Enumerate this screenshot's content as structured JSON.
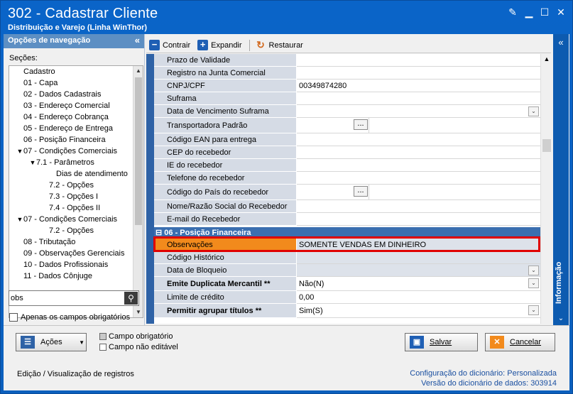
{
  "window": {
    "title": "302 - Cadastrar Cliente",
    "subtitle": "Distribuição e Varejo (Linha WinThor)"
  },
  "nav": {
    "header": "Opções de navegação",
    "sections_label": "Seções:",
    "items": [
      {
        "label": "Cadastro",
        "expander": ""
      },
      {
        "label": "01 - Capa",
        "expander": ""
      },
      {
        "label": "02 - Dados Cadastrais",
        "expander": ""
      },
      {
        "label": "03 - Endereço Comercial",
        "expander": ""
      },
      {
        "label": "04 - Endereço Cobrança",
        "expander": ""
      },
      {
        "label": "05 - Endereço de Entrega",
        "expander": ""
      },
      {
        "label": "06 - Posição Financeira",
        "expander": ""
      },
      {
        "label": "07 - Condições Comerciais",
        "expander": "▼"
      },
      {
        "label": "7.1 - Parâmetros",
        "expander": "▼"
      },
      {
        "label": "Dias de atendimento",
        "expander": ""
      },
      {
        "label": "7.2 - Opções",
        "expander": ""
      },
      {
        "label": "7.3 - Opções I",
        "expander": ""
      },
      {
        "label": "7.4 - Opções II",
        "expander": ""
      },
      {
        "label": "07 - Condições Comerciais",
        "expander": "▼"
      },
      {
        "label": "7.2 - Opções",
        "expander": ""
      },
      {
        "label": "08 - Tributação",
        "expander": ""
      },
      {
        "label": "09 - Observações Gerenciais",
        "expander": ""
      },
      {
        "label": "10 - Dados Profissionais",
        "expander": ""
      },
      {
        "label": "11 - Dados Cônjuge",
        "expander": ""
      }
    ],
    "search_value": "obs",
    "only_required_label": "Apenas os campos obrigatórios"
  },
  "toolbar": {
    "collapse": "Contrair",
    "expand": "Expandir",
    "restore": "Restaurar"
  },
  "grid": {
    "rows": [
      {
        "label": "Prazo de Validade",
        "value": "",
        "bold": false,
        "control": "none",
        "shade": false
      },
      {
        "label": "Registro na Junta Comercial",
        "value": "",
        "bold": false,
        "control": "none",
        "shade": false
      },
      {
        "label": "CNPJ/CPF",
        "value": "00349874280",
        "bold": false,
        "control": "none",
        "shade": false
      },
      {
        "label": "Suframa",
        "value": "",
        "bold": false,
        "control": "none",
        "shade": false
      },
      {
        "label": "Data de Vencimento Suframa",
        "value": "",
        "bold": false,
        "control": "dropdown",
        "shade": false
      },
      {
        "label": "Transportadora Padrão",
        "value": "",
        "bold": false,
        "control": "ellipsis",
        "shade": false
      },
      {
        "label": "Código EAN para entrega",
        "value": "",
        "bold": false,
        "control": "none",
        "shade": false
      },
      {
        "label": "CEP do recebedor",
        "value": "",
        "bold": false,
        "control": "none",
        "shade": false
      },
      {
        "label": "IE do recebedor",
        "value": "",
        "bold": false,
        "control": "none",
        "shade": false
      },
      {
        "label": "Telefone do recebedor",
        "value": "",
        "bold": false,
        "control": "none",
        "shade": false
      },
      {
        "label": "Código do País do recebedor",
        "value": "",
        "bold": false,
        "control": "ellipsis",
        "shade": false
      },
      {
        "label": "Nome/Razão Social do Recebedor",
        "value": "",
        "bold": false,
        "control": "none",
        "shade": false
      },
      {
        "label": "E-mail do Recebedor",
        "value": "",
        "bold": false,
        "control": "none",
        "shade": false
      }
    ],
    "section_header": "06 - Posição Financeira",
    "section_rows": [
      {
        "label": "Observações",
        "value": "SOMENTE VENDAS EM DINHEIRO",
        "bold": false,
        "control": "none",
        "shade": true
      },
      {
        "label": "Código Histórico",
        "value": "",
        "bold": false,
        "control": "none",
        "shade": true
      },
      {
        "label": "Data de Bloqueio",
        "value": "",
        "bold": false,
        "control": "dropdown",
        "shade": true
      },
      {
        "label": "Emite Duplicata Mercantil **",
        "value": "Não(N)",
        "bold": true,
        "control": "dropdown",
        "shade": false
      },
      {
        "label": "Limite de crédito",
        "value": "0,00",
        "bold": false,
        "control": "none",
        "shade": false
      },
      {
        "label": "Permitir agrupar títulos **",
        "value": "Sim(S)",
        "bold": true,
        "control": "dropdown",
        "shade": false
      }
    ]
  },
  "info_panel": {
    "label": "Informação"
  },
  "bottom": {
    "actions_label": "Ações",
    "legend_required": "Campo obrigatório",
    "legend_readonly": "Campo não editável",
    "save_label": "Salvar",
    "cancel_label": "Cancelar",
    "status_left": "Edição / Visualização de registros",
    "dict_config_label": "Configuração do dicionário:",
    "dict_config_value": "Personalizada",
    "dict_version_label": "Versão do dicionário de dados:",
    "dict_version_value": "303914"
  },
  "colors": {
    "highlight": "#e00000",
    "observacoes_label_bg": "#f28a1c",
    "window_blue": "#0a64c8"
  }
}
